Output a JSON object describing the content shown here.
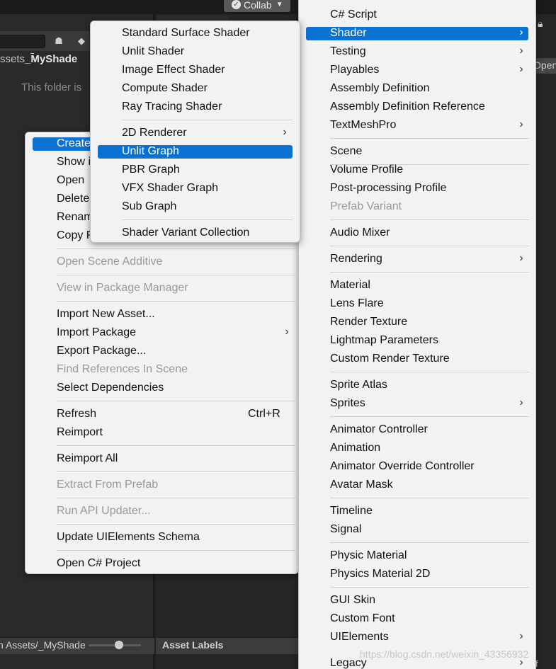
{
  "editor": {
    "collab_label": "Collab",
    "breadcrumb_root": "ssets",
    "breadcrumb_folder": "_MyShade",
    "empty_folder_text": "This folder is",
    "open_button_label": "Open",
    "path_text": "n Assets/_MyShade",
    "asset_labels": "Asset Labels",
    "watermark": "https://blog.csdn.net/weixin_43356932",
    "trailing_char": "f"
  },
  "context_menu": {
    "items": [
      {
        "label": "Create",
        "highlight": true
      },
      {
        "label": "Show i"
      },
      {
        "label": "Open"
      },
      {
        "label": "Delete"
      },
      {
        "label": "Renam"
      },
      {
        "label": "Copy P"
      },
      {
        "label": "Open Scene Additive",
        "disabled": true
      },
      {
        "label": "View in Package Manager",
        "disabled": true
      },
      {
        "label": "Import New Asset..."
      },
      {
        "label": "Import Package",
        "submenu": true
      },
      {
        "label": "Export Package..."
      },
      {
        "label": "Find References In Scene",
        "disabled": true
      },
      {
        "label": "Select Dependencies"
      },
      {
        "label": "Refresh",
        "shortcut": "Ctrl+R"
      },
      {
        "label": "Reimport"
      },
      {
        "label": "Reimport All"
      },
      {
        "label": "Extract From Prefab",
        "disabled": true
      },
      {
        "label": "Run API Updater...",
        "disabled": true
      },
      {
        "label": "Update UIElements Schema"
      },
      {
        "label": "Open C# Project"
      }
    ]
  },
  "shader_menu": {
    "items": [
      {
        "label": "Standard Surface Shader"
      },
      {
        "label": "Unlit Shader"
      },
      {
        "label": "Image Effect Shader"
      },
      {
        "label": "Compute Shader"
      },
      {
        "label": "Ray Tracing Shader"
      },
      {
        "label": "2D Renderer",
        "submenu": true
      },
      {
        "label": "Unlit Graph",
        "highlight": true
      },
      {
        "label": "PBR Graph"
      },
      {
        "label": "VFX Shader Graph"
      },
      {
        "label": "Sub Graph"
      },
      {
        "label": "Shader Variant Collection"
      }
    ]
  },
  "create_menu": {
    "items": [
      {
        "label": "C# Script"
      },
      {
        "label": "Shader",
        "highlight": true,
        "submenu": true
      },
      {
        "label": "Testing",
        "submenu": true
      },
      {
        "label": "Playables",
        "submenu": true
      },
      {
        "label": "Assembly Definition"
      },
      {
        "label": "Assembly Definition Reference"
      },
      {
        "label": "TextMeshPro",
        "submenu": true
      },
      {
        "label": "Scene"
      },
      {
        "label": "Volume Profile"
      },
      {
        "label": "Post-processing Profile"
      },
      {
        "label": "Prefab Variant",
        "disabled": true
      },
      {
        "label": "Audio Mixer"
      },
      {
        "label": "Rendering",
        "submenu": true
      },
      {
        "label": "Material"
      },
      {
        "label": "Lens Flare"
      },
      {
        "label": "Render Texture"
      },
      {
        "label": "Lightmap Parameters"
      },
      {
        "label": "Custom Render Texture"
      },
      {
        "label": "Sprite Atlas"
      },
      {
        "label": "Sprites",
        "submenu": true
      },
      {
        "label": "Animator Controller"
      },
      {
        "label": "Animation"
      },
      {
        "label": "Animator Override Controller"
      },
      {
        "label": "Avatar Mask"
      },
      {
        "label": "Timeline"
      },
      {
        "label": "Signal"
      },
      {
        "label": "Physic Material"
      },
      {
        "label": "Physics Material 2D"
      },
      {
        "label": "GUI Skin"
      },
      {
        "label": "Custom Font"
      },
      {
        "label": "UIElements",
        "submenu": true
      },
      {
        "label": "Legacy",
        "submenu": true
      }
    ]
  }
}
